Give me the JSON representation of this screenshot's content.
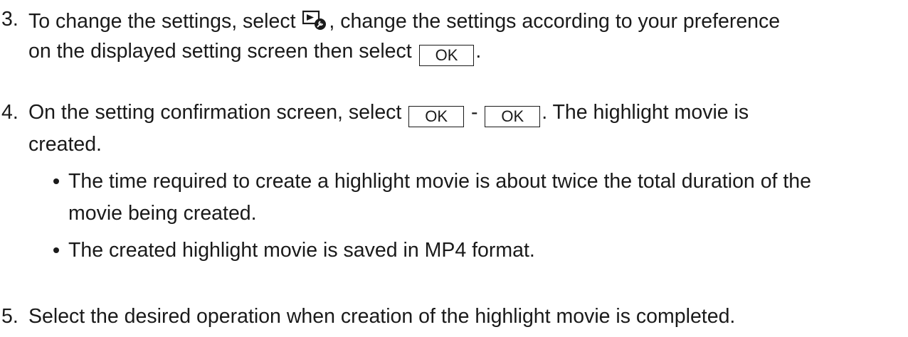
{
  "step3": {
    "number": "3.",
    "line1_before": "To change the settings, select ",
    "settings_icon": "playback-settings-icon",
    "line1_after": ", change the settings according to your preference",
    "line2_before": "on the displayed setting screen then select ",
    "ok_label": "OK",
    "line2_after": "."
  },
  "step4": {
    "number": "4.",
    "line1_before": "On the setting confirmation screen, select ",
    "ok_label_1": "OK",
    "separator": " - ",
    "ok_label_2": "OK",
    "line1_after": ". The highlight movie is",
    "line2": "created.",
    "bullets": [
      {
        "line1": "The time required to create a highlight movie is about twice the total duration of the",
        "line2": "movie being created."
      },
      {
        "line1": "The created highlight movie is saved in MP4 format."
      }
    ]
  },
  "step5": {
    "number": "5.",
    "text": "Select the desired operation when creation of the highlight movie is completed."
  }
}
